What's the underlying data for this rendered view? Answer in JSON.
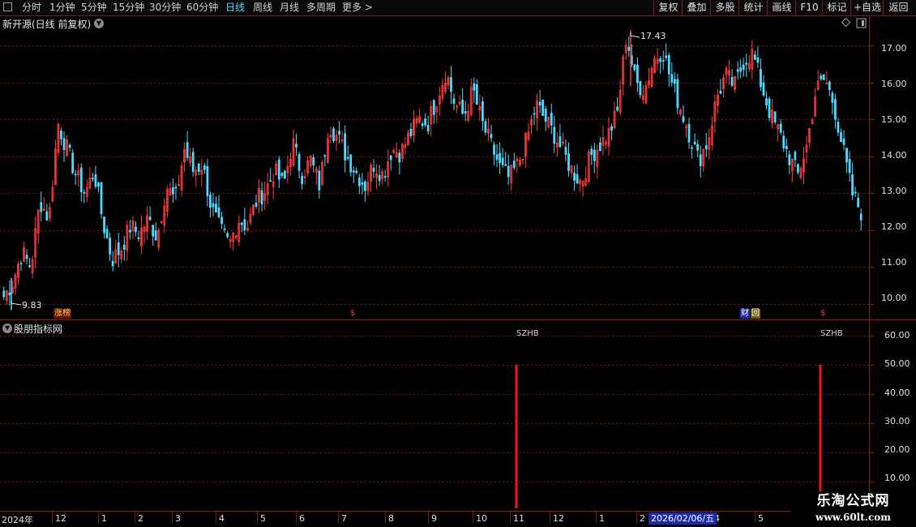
{
  "toolbar": {
    "periods": [
      "分时",
      "1分钟",
      "5分钟",
      "15分钟",
      "30分钟",
      "60分钟",
      "日线",
      "周线",
      "月线",
      "多周期",
      "更多 >"
    ],
    "active_period": "日线",
    "right_buttons": [
      "复权",
      "叠加",
      "多股",
      "统计",
      "画线",
      "F10",
      "标记",
      "+自选",
      "返回"
    ]
  },
  "stock": {
    "title": "新开源(日线 前复权)"
  },
  "indicator": {
    "title": "股朋指标网"
  },
  "markers": {
    "zhangbang": "涨榜",
    "dollar1": "$",
    "caibao": "财",
    "caibao2": "回",
    "dollar2": "$"
  },
  "signals": {
    "label1": "SZHB",
    "label2": "SZHB",
    "value1": 50,
    "value2": 50
  },
  "annotations": {
    "peak": "17.43",
    "low": "9.83"
  },
  "x_axis": {
    "labels": [
      "2024年",
      "12",
      "1",
      "2",
      "3",
      "4",
      "5",
      "6",
      "7",
      "8",
      "9",
      "10",
      "11",
      "12",
      "1",
      "2",
      "3",
      "4",
      "5"
    ],
    "highlight_date": "2026/02/06/五"
  },
  "watermark": {
    "cn": "乐淘公式网",
    "url": "www.60lt.com"
  },
  "colors": {
    "up": "#ff3b3b",
    "down": "#4fd8ff",
    "grid": "#7a1a1a",
    "signal": "#ff1010",
    "accent": "#4fd8ff"
  },
  "chart_data": [
    {
      "type": "candlestick",
      "title": "新开源(日线 前复权)",
      "y_ticks": [
        "17.00",
        "16.00",
        "15.00",
        "14.00",
        "13.00",
        "12.00",
        "11.00",
        "10.00"
      ],
      "ylim": [
        9.6,
        17.8
      ],
      "period_high": 17.43,
      "period_low": 9.83,
      "close_path": [
        10.2,
        10.6,
        11.4,
        11.0,
        12.8,
        12.3,
        14.9,
        14.2,
        13.5,
        13.0,
        13.6,
        12.2,
        11.2,
        11.5,
        12.1,
        11.9,
        12.3,
        11.8,
        13.2,
        12.8,
        14.2,
        13.6,
        13.8,
        12.6,
        12.0,
        11.6,
        12.3,
        12.1,
        12.8,
        13.1,
        13.6,
        13.2,
        14.4,
        13.5,
        13.9,
        13.2,
        14.9,
        14.5,
        14.0,
        13.6,
        13.2,
        13.8,
        13.5,
        14.2,
        14.1,
        14.6,
        15.0,
        14.9,
        15.6,
        16.3,
        15.4,
        15.1,
        15.8,
        14.9,
        14.3,
        13.7,
        13.4,
        13.8,
        14.5,
        15.4,
        15.0,
        14.6,
        14.1,
        13.6,
        13.3,
        14.0,
        14.3,
        14.6,
        15.2,
        17.3,
        16.0,
        15.8,
        16.6,
        16.9,
        16.0,
        15.3,
        14.6,
        13.9,
        14.4,
        15.6,
        16.2,
        15.9,
        16.6,
        16.8,
        15.9,
        15.1,
        14.6,
        14.0,
        13.5,
        14.3,
        15.8,
        16.1,
        15.4,
        14.2,
        13.0,
        12.5
      ]
    },
    {
      "type": "bar",
      "title": "股朋指标网",
      "y_ticks": [
        "60.00",
        "50.00",
        "40.00",
        "30.00",
        "20.00",
        "10.00"
      ],
      "ylim": [
        0,
        65
      ],
      "series": [
        {
          "name": "SZHB",
          "values": [
            50,
            50
          ]
        }
      ],
      "x": [
        "11",
        "4"
      ]
    }
  ]
}
